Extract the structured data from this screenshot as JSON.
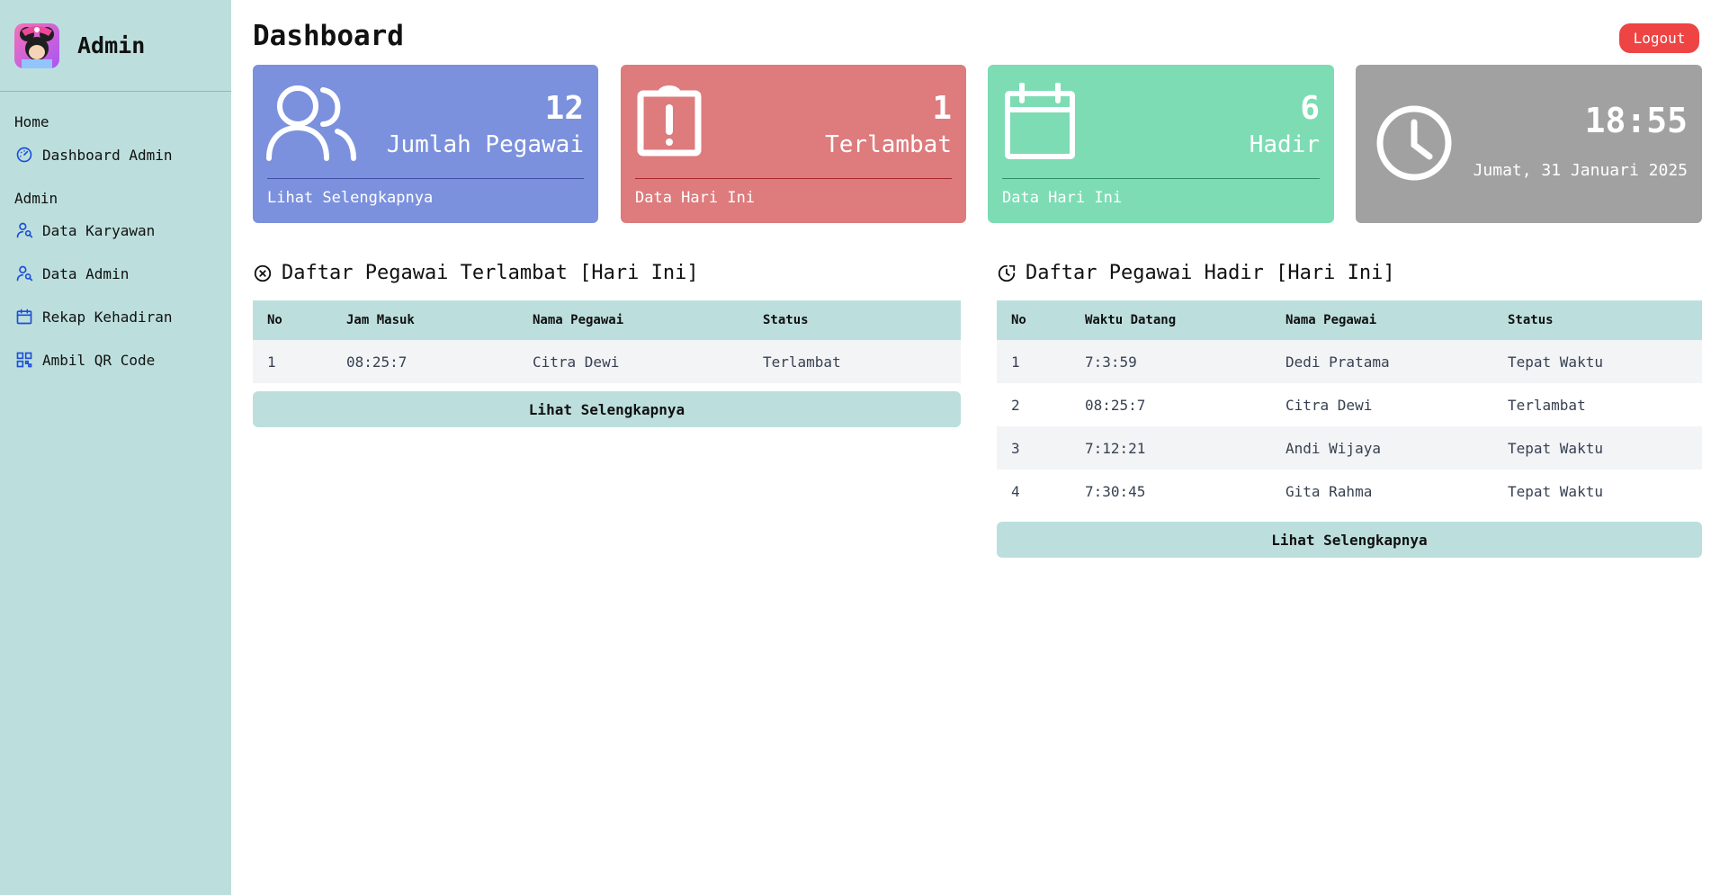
{
  "sidebar": {
    "brand_title": "Admin",
    "sections": [
      {
        "title": "Home",
        "items": [
          {
            "label": "Dashboard Admin",
            "icon": "gauge-icon"
          }
        ]
      },
      {
        "title": "Admin",
        "items": [
          {
            "label": "Data Karyawan",
            "icon": "users-icon"
          },
          {
            "label": "Data Admin",
            "icon": "users-icon"
          },
          {
            "label": "Rekap Kehadiran",
            "icon": "calendar-icon"
          },
          {
            "label": "Ambil QR Code",
            "icon": "qr-code-icon"
          }
        ]
      }
    ]
  },
  "header": {
    "title": "Dashboard",
    "logout_label": "Logout"
  },
  "cards": [
    {
      "count": "12",
      "label": "Jumlah Pegawai",
      "footer": "Lihat Selengkapnya",
      "color": "#7b91dd",
      "icon": "users-icon"
    },
    {
      "count": "1",
      "label": "Terlambat",
      "footer": "Data Hari Ini",
      "color": "#dd7b7d",
      "icon": "clipboard-alert-icon"
    },
    {
      "count": "6",
      "label": "Hadir",
      "footer": "Data Hari Ini",
      "color": "#7ddcb4",
      "icon": "calendar-icon"
    },
    {
      "time": "18:55",
      "date": "Jumat, 31 Januari 2025",
      "color": "#a1a1a1",
      "icon": "clock-icon"
    }
  ],
  "late_table": {
    "title": "Daftar Pegawai Terlambat [Hari Ini]",
    "icon": "x-circle-icon",
    "columns": [
      "No",
      "Jam Masuk",
      "Nama Pegawai",
      "Status"
    ],
    "rows": [
      [
        "1",
        "08:25:7",
        "Citra Dewi",
        "Terlambat"
      ]
    ],
    "more_label": "Lihat Selengkapnya"
  },
  "present_table": {
    "title": "Daftar Pegawai Hadir [Hari Ini]",
    "icon": "clock-check-icon",
    "columns": [
      "No",
      "Waktu Datang",
      "Nama Pegawai",
      "Status"
    ],
    "rows": [
      [
        "1",
        "7:3:59",
        "Dedi Pratama",
        "Tepat Waktu"
      ],
      [
        "2",
        "08:25:7",
        "Citra Dewi",
        "Terlambat"
      ],
      [
        "3",
        "7:12:21",
        "Andi Wijaya",
        "Tepat Waktu"
      ],
      [
        "4",
        "7:30:45",
        "Gita Rahma",
        "Tepat Waktu"
      ]
    ],
    "more_label": "Lihat Selengkapnya"
  }
}
